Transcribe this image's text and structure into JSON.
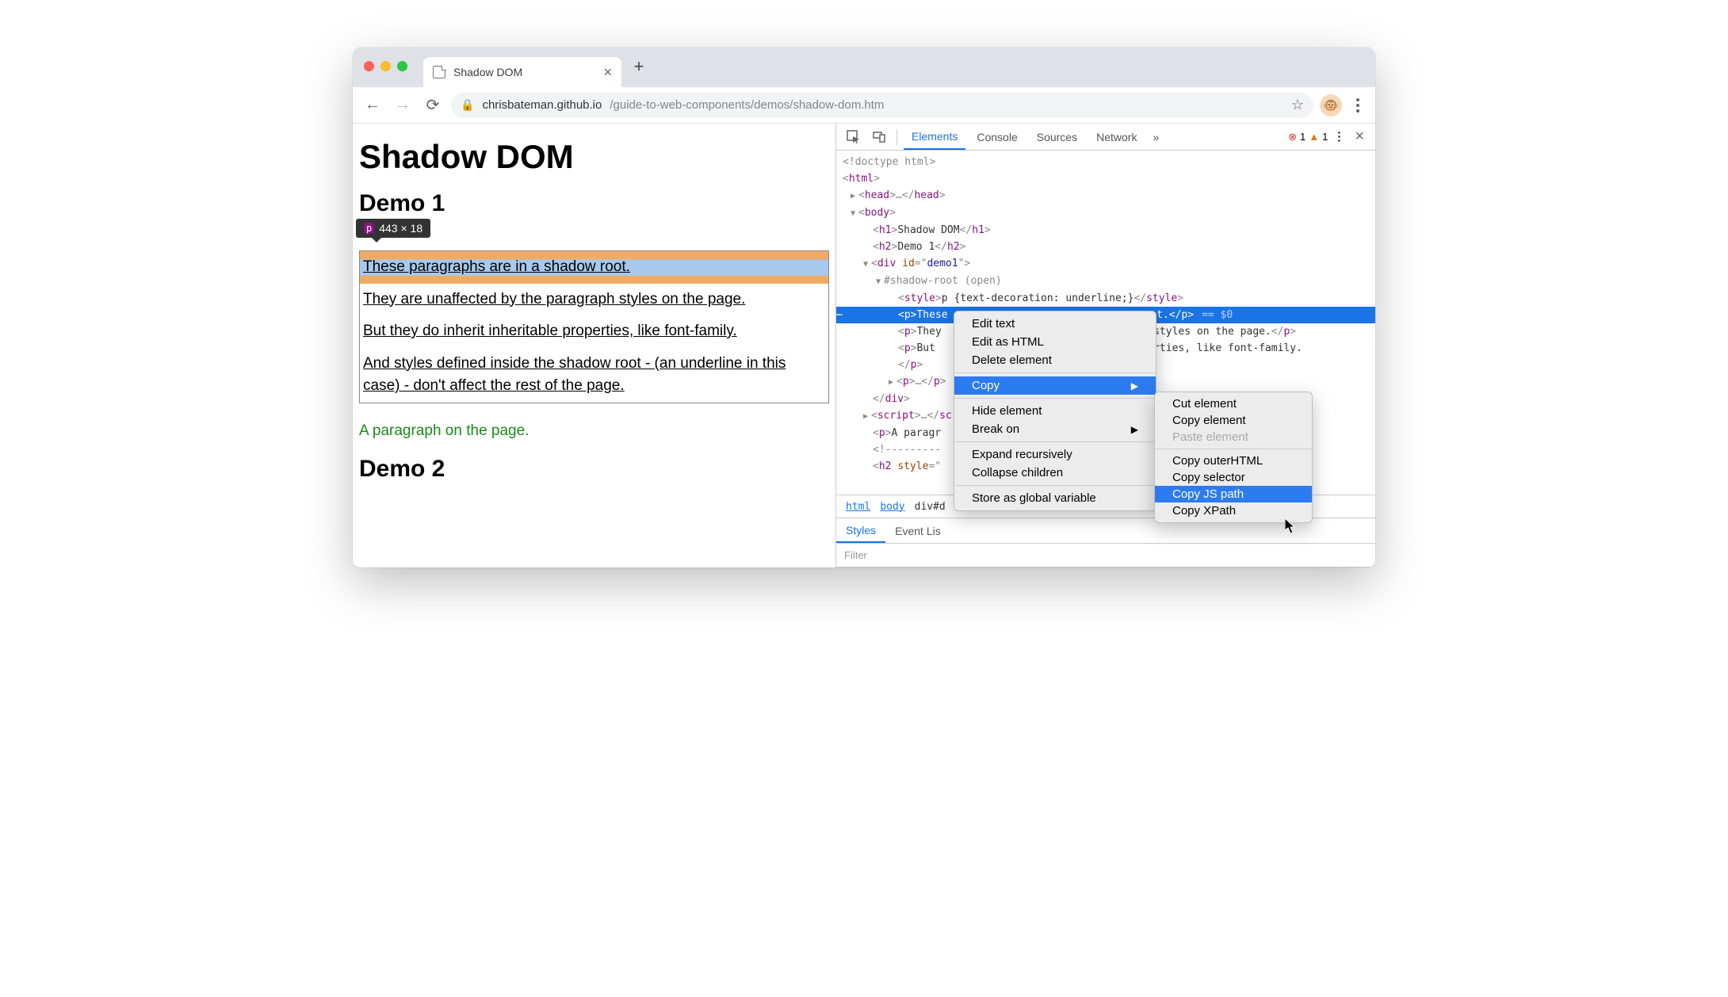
{
  "browser": {
    "tab_title": "Shadow DOM",
    "url_host": "chrisbateman.github.io",
    "url_path": "/guide-to-web-components/demos/shadow-dom.htm"
  },
  "page": {
    "h1": "Shadow DOM",
    "h2_1": "Demo 1",
    "h2_2": "Demo 2",
    "tooltip_tag": "p",
    "tooltip_dims": "443 × 18",
    "shadow_paragraphs": [
      "These paragraphs are in a shadow root.",
      "They are unaffected by the paragraph styles on the page.",
      "But they do inherit inheritable properties, like font-family.",
      "And styles defined inside the shadow root - (an underline in this case) - don't affect the rest of the page."
    ],
    "page_paragraph": "A paragraph on the page."
  },
  "devtools": {
    "tabs": [
      "Elements",
      "Console",
      "Sources",
      "Network"
    ],
    "more_glyph": "»",
    "error_count": "1",
    "warning_count": "1",
    "dom_lines": {
      "doctype": "<!doctype html>",
      "html": "html",
      "head": "head",
      "body": "body",
      "h1_text": "Shadow DOM",
      "h2_text": "Demo 1",
      "div_id": "demo1",
      "shadow_label": "#shadow-root (open)",
      "style_inner": "p {text-decoration: underline;}",
      "p_sel_start": "These",
      "p_sel_end": "root.",
      "sel_ref": "== $0",
      "p2_start": "They",
      "p2_end": "aph styles on the page.",
      "p3_start": "But ",
      "p3_end": "roperties, like font-family.",
      "script": "script",
      "page_para_start": "A paragr",
      "comment": "<!---------",
      "h2_style": "h2 style=\""
    },
    "breadcrumb": [
      "html",
      "body",
      "div#d"
    ],
    "styles_tabs": [
      "Styles",
      "Event Lis"
    ],
    "filter_placeholder": "Filter"
  },
  "context_menu": {
    "items": [
      "Edit text",
      "Edit as HTML",
      "Delete element"
    ],
    "copy_label": "Copy",
    "items2": [
      "Hide element",
      "Break on"
    ],
    "items3": [
      "Expand recursively",
      "Collapse children"
    ],
    "items4": [
      "Store as global variable"
    ]
  },
  "submenu": {
    "g1": [
      "Cut element",
      "Copy element",
      "Paste element"
    ],
    "g2": [
      "Copy outerHTML",
      "Copy selector",
      "Copy JS path",
      "Copy XPath"
    ]
  }
}
